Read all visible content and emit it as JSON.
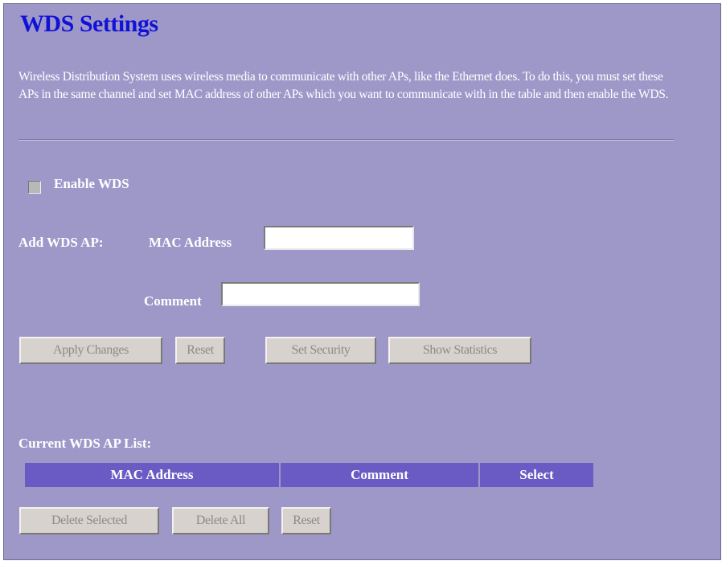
{
  "page": {
    "title": "WDS Settings",
    "description": "Wireless Distribution System uses wireless media to communicate with other APs, like the Ethernet does. To do this, you must set these APs in the same channel and set MAC address of other APs which you want to communicate with in the table and then enable the WDS."
  },
  "enable_wds": {
    "label": "Enable WDS",
    "checked": false
  },
  "add_ap": {
    "section_label": "Add WDS AP:",
    "mac_label": "MAC Address",
    "mac_value": "",
    "comment_label": "Comment",
    "comment_value": ""
  },
  "buttons": {
    "apply": "Apply Changes",
    "reset": "Reset",
    "set_security": "Set Security",
    "show_statistics": "Show Statistics"
  },
  "ap_list": {
    "label": "Current WDS AP List:",
    "columns": [
      "MAC Address",
      "Comment",
      "Select"
    ],
    "rows": []
  },
  "list_buttons": {
    "delete_selected": "Delete Selected",
    "delete_all": "Delete All",
    "reset": "Reset"
  },
  "colors": {
    "background": "#9e98c9",
    "title": "#1212d6",
    "table_header": "#6a5bc4"
  }
}
